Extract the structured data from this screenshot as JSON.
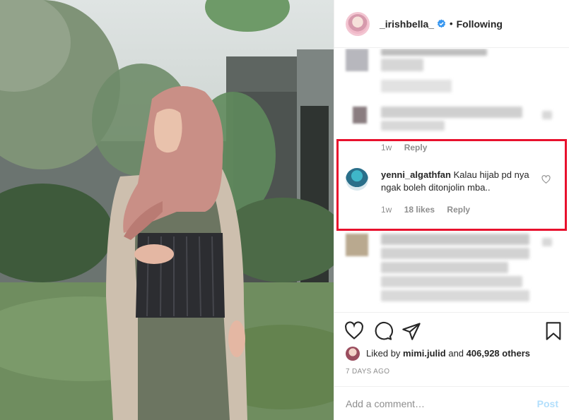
{
  "post": {
    "username": "_irishbella_",
    "follow_state": "Following",
    "separator": "•"
  },
  "comments": {
    "first_reply_time": "1w",
    "first_reply_label": "Reply",
    "highlighted": {
      "username": "yenni_algathfan",
      "text": "Kalau hijab pd nya ngak boleh ditonjolin mba..",
      "time": "1w",
      "likes": "18 likes",
      "reply_label": "Reply"
    }
  },
  "footer": {
    "liked_prefix": "Liked by",
    "liked_user": "mimi.julid",
    "liked_and": "and",
    "liked_others": "406,928 others",
    "timestamp": "7 DAYS AGO",
    "comment_placeholder": "Add a comment…",
    "post_label": "Post"
  },
  "colors": {
    "highlight_border": "#e8112d",
    "verified_badge": "#3897f0",
    "post_button_disabled": "#b2dffc"
  },
  "icons": {
    "like": "heart-outline-icon",
    "comment": "speech-bubble-icon",
    "share": "paper-plane-icon",
    "save": "bookmark-icon"
  }
}
